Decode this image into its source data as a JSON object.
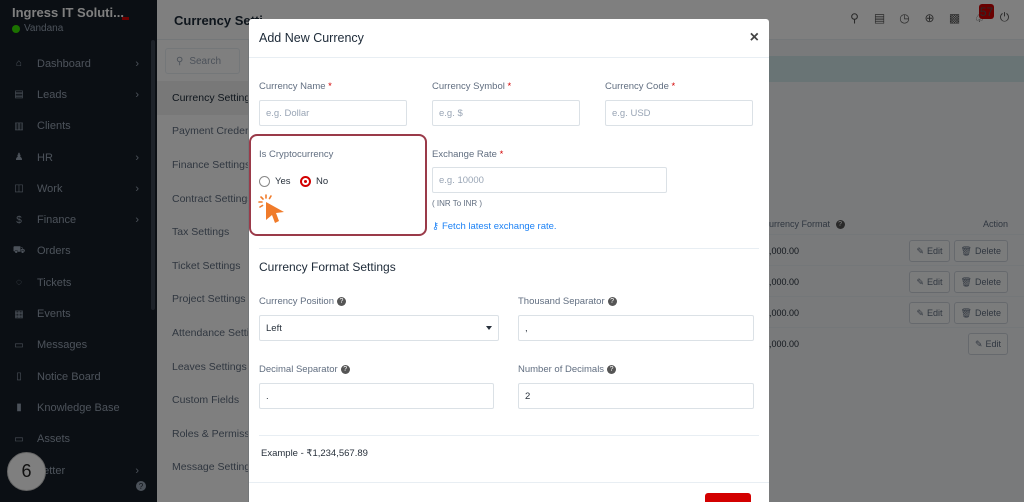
{
  "brand": {
    "name": "Ingress IT Soluti...",
    "user": "Vandana"
  },
  "sidebar": {
    "items": [
      {
        "label": "Dashboard",
        "icon": "home-icon",
        "chev": true
      },
      {
        "label": "Leads",
        "icon": "leads-icon",
        "chev": true
      },
      {
        "label": "Clients",
        "icon": "clients-icon",
        "chev": false
      },
      {
        "label": "HR",
        "icon": "hr-icon",
        "chev": true
      },
      {
        "label": "Work",
        "icon": "work-icon",
        "chev": true
      },
      {
        "label": "Finance",
        "icon": "finance-icon",
        "chev": true
      },
      {
        "label": "Orders",
        "icon": "cart-icon",
        "chev": false
      },
      {
        "label": "Tickets",
        "icon": "ticket-icon",
        "chev": false
      },
      {
        "label": "Events",
        "icon": "calendar-icon",
        "chev": false
      },
      {
        "label": "Messages",
        "icon": "messages-icon",
        "chev": false
      },
      {
        "label": "Notice Board",
        "icon": "notice-icon",
        "chev": false
      },
      {
        "label": "Knowledge Base",
        "icon": "knowledge-icon",
        "chev": false
      },
      {
        "label": "Assets",
        "icon": "assets-icon",
        "chev": false
      },
      {
        "label": "Letter",
        "icon": "letter-icon",
        "chev": true
      }
    ]
  },
  "step_number": "6",
  "header": {
    "title": "Currency Setti",
    "notif_count": "57"
  },
  "settings_nav": {
    "search_placeholder": "Search",
    "items": [
      "Currency Settings",
      "Payment Credentials",
      "Finance Settings",
      "Contract Settings",
      "Tax Settings",
      "Ticket Settings",
      "Project Settings",
      "Attendance Settings",
      "Leaves Settings",
      "Custom Fields",
      "Roles & Permissions",
      "Message Settings"
    ]
  },
  "table": {
    "col_format": "urrency Format",
    "col_action": "Action",
    "rows": [
      {
        "value": ",000.00",
        "edit": "Edit",
        "delete": "Delete",
        "has_delete": true
      },
      {
        "value": ",000.00",
        "edit": "Edit",
        "delete": "Delete",
        "has_delete": true
      },
      {
        "value": ",000.00",
        "edit": "Edit",
        "delete": "Delete",
        "has_delete": true
      },
      {
        "value": ",000.00",
        "edit": "Edit",
        "delete": "",
        "has_delete": false
      }
    ]
  },
  "modal": {
    "title": "Add New Currency",
    "close": "×",
    "currency_name": {
      "label": "Currency Name",
      "placeholder": "e.g. Dollar"
    },
    "currency_symbol": {
      "label": "Currency Symbol",
      "placeholder": "e.g. $"
    },
    "currency_code": {
      "label": "Currency Code",
      "placeholder": "e.g. USD"
    },
    "crypto": {
      "label": "Is Cryptocurrency",
      "yes": "Yes",
      "no": "No",
      "selected": "No"
    },
    "exchange_rate": {
      "label": "Exchange Rate",
      "placeholder": "e.g. 10000",
      "hint": "( INR To INR )",
      "fetch_link": "Fetch latest exchange rate."
    },
    "format_section": "Currency Format Settings",
    "currency_position": {
      "label": "Currency Position",
      "value": "Left"
    },
    "thousand_separator": {
      "label": "Thousand Separator",
      "value": ","
    },
    "decimal_separator": {
      "label": "Decimal Separator",
      "value": "."
    },
    "num_decimals": {
      "label": "Number of Decimals",
      "value": "2"
    },
    "example": "Example - ₹1,234,567.89"
  },
  "colors": {
    "accent": "#d30000",
    "sidebar_bg": "#171f29",
    "highlight_border": "#9a3a49",
    "link": "#1d82f5",
    "cursor": "#f07b2a"
  }
}
